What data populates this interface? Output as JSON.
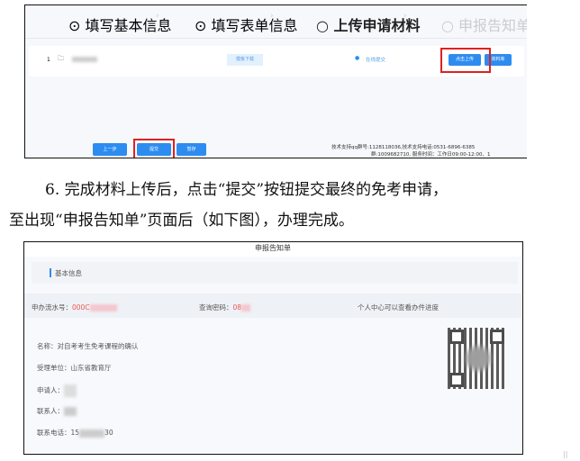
{
  "top_screenshot": {
    "steps": [
      "填写基本信息",
      "填写表单信息",
      "上传申请材料",
      "申报告知单"
    ],
    "row": {
      "index": "1",
      "template_label": "模板下载",
      "status": "在线提交",
      "upload_label": "点击上传",
      "library_label": "资料库"
    },
    "buttons": {
      "prev": "上一步",
      "submit": "提交",
      "save": "暂存"
    },
    "support_line1": "技术支持qq群号:1128118036,技术支持电话:0531-6896-6385",
    "support_line2": "群:1009682710, 服务时间：工作日09:00-12:00、1"
  },
  "instruction": {
    "line1": "6. 完成材料上传后，点击“提交”按钮提交最终的免考申请，",
    "line2": "至出现“申报告知单”页面后（如下图），办理完成。"
  },
  "bottom_screenshot": {
    "title": "申报告知单",
    "section": "基本信息",
    "serial_label": "申办流水号：",
    "serial_value": "000C",
    "query_label": "查询密码：",
    "query_value": "08",
    "hint": "个人中心可以查看办件进度",
    "name": "名称：对自考考生免考课程的确认",
    "unit": "受理单位：山东省教育厅",
    "applicant": "申请人：",
    "contact": "联系人：",
    "phone_label": "联系电话：",
    "phone_start": "15",
    "phone_end": "30"
  },
  "colors": {
    "accent": "#2d8cf0",
    "highlight": "#e02020",
    "done_step": "#7cc07c"
  }
}
